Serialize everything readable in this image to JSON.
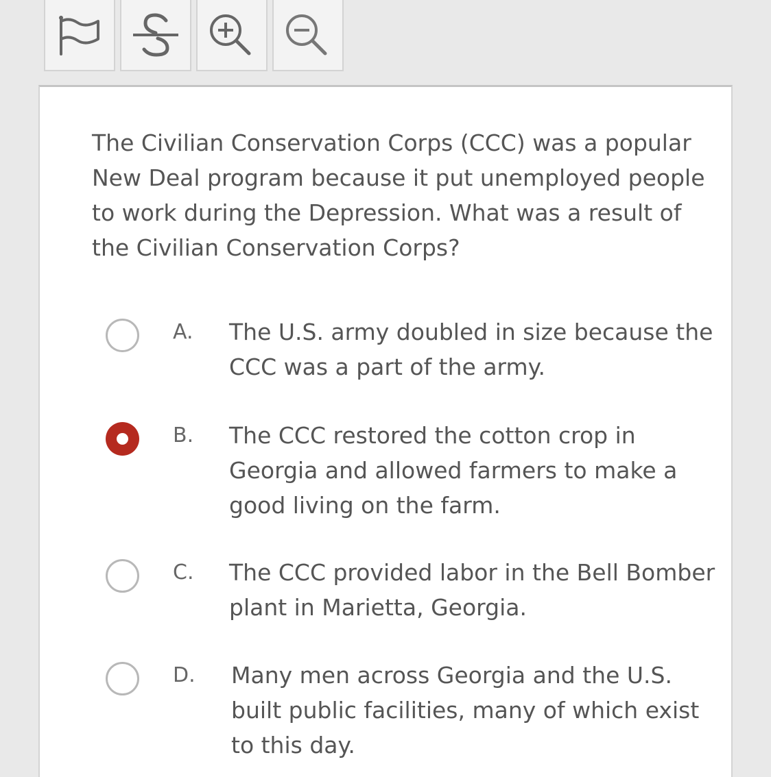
{
  "toolbar": {
    "buttons": [
      {
        "icon": "flag-icon"
      },
      {
        "icon": "strikethrough-icon"
      },
      {
        "icon": "zoom-in-icon"
      },
      {
        "icon": "zoom-out-icon"
      }
    ]
  },
  "question": {
    "text": "The Civilian Conservation Corps (CCC) was a popular New Deal program because it put unemployed people to work during the Depression. What was a result of the Civilian Conservation Corps?"
  },
  "options": [
    {
      "letter": "A.",
      "text": "The U.S. army doubled in size because the CCC was a part of the army.",
      "selected": false
    },
    {
      "letter": "B.",
      "text": "The CCC restored the cotton crop in Georgia and allowed farmers to make a good living on the farm.",
      "selected": true
    },
    {
      "letter": "C.",
      "text": "The CCC provided labor in the Bell Bomber plant in Marietta, Georgia.",
      "selected": false
    },
    {
      "letter": "D.",
      "text": "Many men across Georgia and the U.S. built public facilities, many of which exist to this day.",
      "selected": false
    }
  ],
  "colors": {
    "selected_radio": "#b52a1f",
    "text": "#555555",
    "background": "#e9e9e9"
  }
}
